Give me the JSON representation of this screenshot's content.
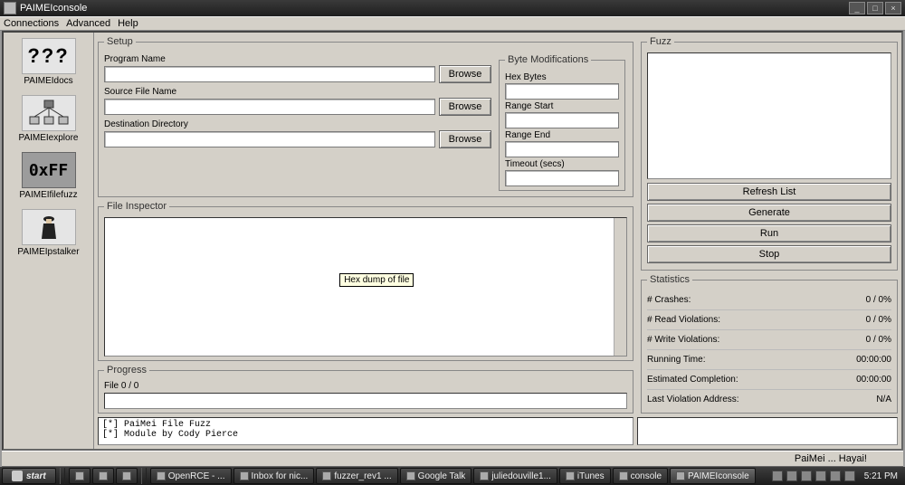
{
  "window": {
    "title": "PAIMEIconsole"
  },
  "menu": {
    "items": [
      "Connections",
      "Advanced",
      "Help"
    ]
  },
  "sidebar": {
    "items": [
      {
        "icon": "???",
        "label": "PAIMEIdocs"
      },
      {
        "icon": "tree",
        "label": "PAIMEIexplore"
      },
      {
        "icon": "0xFF",
        "label": "PAIMEIfilefuzz"
      },
      {
        "icon": "spy",
        "label": "PAIMEIpstalker"
      }
    ]
  },
  "setup": {
    "legend": "Setup",
    "program_name_label": "Program Name",
    "program_name": "",
    "source_file_label": "Source File Name",
    "source_file": "",
    "dest_dir_label": "Destination Directory",
    "dest_dir": "",
    "browse_label": "Browse"
  },
  "bytemod": {
    "legend": "Byte Modifications",
    "hexbytes_label": "Hex Bytes",
    "hexbytes": "",
    "range_start_label": "Range Start",
    "range_start": "",
    "range_end_label": "Range End",
    "range_end": "",
    "timeout_label": "Timeout (secs)",
    "timeout": ""
  },
  "file_inspector": {
    "legend": "File Inspector",
    "tooltip": "Hex dump of file"
  },
  "progress": {
    "legend": "Progress",
    "label": "File 0 / 0"
  },
  "fuzz": {
    "legend": "Fuzz",
    "buttons": {
      "refresh": "Refresh List",
      "generate": "Generate",
      "run": "Run",
      "stop": "Stop"
    }
  },
  "stats": {
    "legend": "Statistics",
    "rows": [
      {
        "label": "# Crashes:",
        "value": "0 / 0%"
      },
      {
        "label": "# Read Violations:",
        "value": "0 / 0%"
      },
      {
        "label": "# Write Violations:",
        "value": "0 / 0%"
      },
      {
        "label": "Running Time:",
        "value": "00:00:00"
      },
      {
        "label": "Estimated Completion:",
        "value": "00:00:00"
      },
      {
        "label": "Last Violation Address:",
        "value": "N/A"
      }
    ]
  },
  "log": "[*] PaiMei File Fuzz\n[*] Module by Cody Pierce",
  "statusbar": {
    "text": "PaiMei ... Hayai!"
  },
  "taskbar": {
    "start": "start",
    "buttons": [
      "",
      "",
      "",
      "OpenRCE - ...",
      "Inbox for nic...",
      "fuzzer_rev1 ...",
      "Google Talk",
      "juliedouville1...",
      "iTunes",
      "console",
      "PAIMEIconsole"
    ],
    "clock": "5:21 PM"
  }
}
